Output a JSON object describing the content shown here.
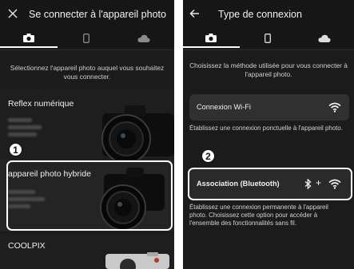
{
  "screen1": {
    "close_icon": "close-icon",
    "title": "Se connecter à l'appareil photo",
    "tabs": [
      "camera-icon",
      "phone-icon",
      "cloud-icon"
    ],
    "intro": "Sélectionnez l'appareil photo auquel vous souhaitez vous connecter.",
    "cameras": [
      {
        "label": "Reflex numérique"
      },
      {
        "label": "appareil photo hybride",
        "highlighted": true
      },
      {
        "label": "COOLPIX"
      }
    ],
    "callout": "1"
  },
  "screen2": {
    "back_icon": "back-arrow-icon",
    "title": "Type de connexion",
    "tabs": [
      "camera-icon",
      "phone-icon",
      "cloud-icon"
    ],
    "intro": "Choisissez la méthode utilisée pour vous connecter à l'appareil photo.",
    "options": [
      {
        "label": "Connexion Wi-Fi",
        "icons": [
          "wifi-icon"
        ],
        "description": "Établissez une connexion ponctuelle à l'appareil photo."
      },
      {
        "label": "Association (Bluetooth)",
        "icons": [
          "bluetooth-icon",
          "wifi-icon"
        ],
        "plus": "+",
        "highlighted": true,
        "description": "Établissez une connexion permanente à l'appareil photo. Choisissez cette option pour accéder à l'ensemble des fonctionnalités sans fil."
      }
    ],
    "callout": "2"
  }
}
